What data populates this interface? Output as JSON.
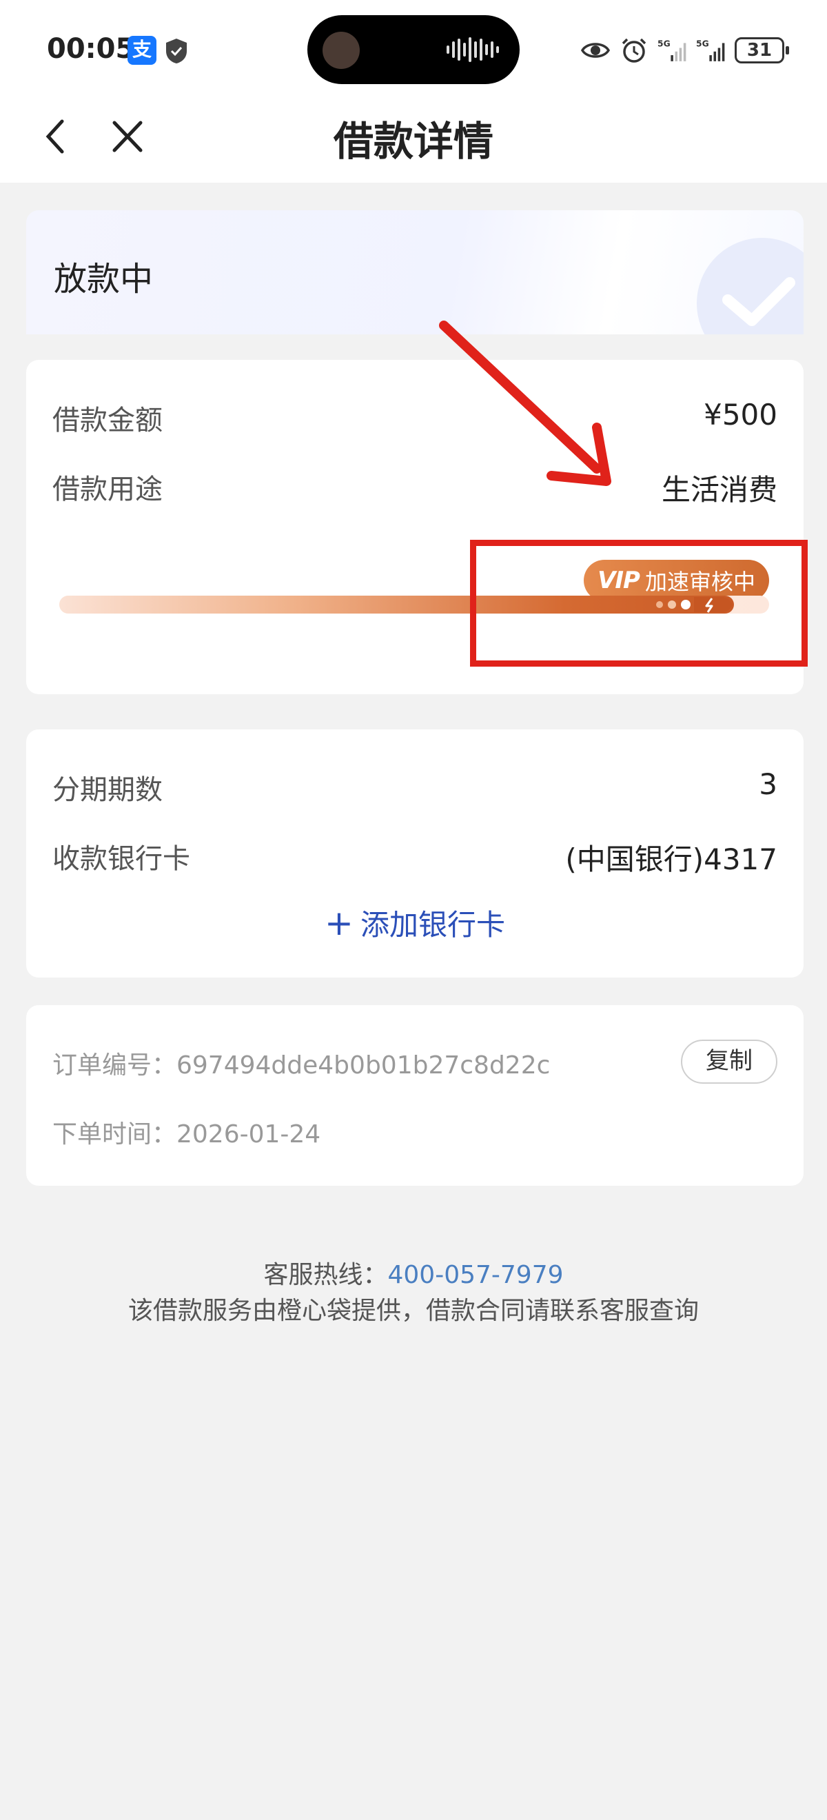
{
  "status_bar": {
    "time": "00:05",
    "app_badge": "支",
    "battery": "31",
    "signal_labels": [
      "5G",
      "5G"
    ]
  },
  "nav": {
    "title": "借款详情"
  },
  "loan_status": {
    "text": "放款中"
  },
  "details": {
    "amount_label": "借款金额",
    "amount_value": "¥500",
    "purpose_label": "借款用途",
    "purpose_value": "生活消费",
    "review_badge_vip": "VIP",
    "review_badge_text": "加速审核中",
    "review_progress": 0.95
  },
  "installments": {
    "periods_label": "分期期数",
    "periods_value": "3",
    "bank_label": "收款银行卡",
    "bank_value": "(中国银行)4317",
    "add_card_label": "添加银行卡"
  },
  "order": {
    "number_text": "订单编号：697494dde4b0b01b27c8d22c",
    "time_text": "下单时间：2026-01-24",
    "copy_label": "复制"
  },
  "footer": {
    "hotline_label": "客服热线：",
    "hotline_number": "400-057-7979",
    "notice": "该借款服务由橙心袋提供，借款合同请联系客服查询"
  },
  "colors": {
    "accent_orange": "#d8733a",
    "link_blue": "#2b4fb8",
    "annotation_red": "#e0221a"
  }
}
